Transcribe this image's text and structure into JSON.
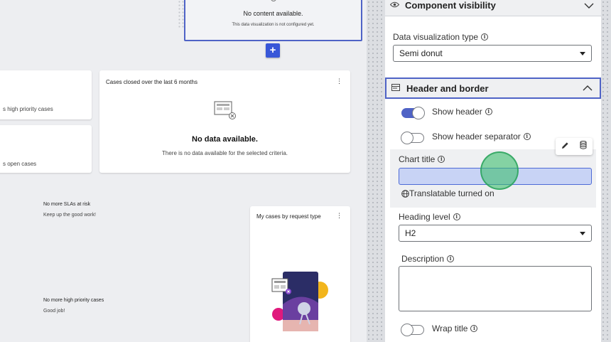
{
  "canvas": {
    "top_widget": {
      "title": "No content available.",
      "subtitle": "This data visualization is not configured yet."
    },
    "add_button": "+",
    "card_high_priority": {
      "text": "s high priority cases"
    },
    "card_open_cases": {
      "text": "s open cases"
    },
    "card_cases_closed": {
      "title": "Cases closed over the last 6 months",
      "heading": "No data available.",
      "text": "There is no data available for the selected criteria."
    },
    "sla_message": {
      "title": "No more SLAs at risk",
      "text": "Keep up the good work!"
    },
    "priority_message": {
      "title": "No more high priority cases",
      "text": "Good job!"
    },
    "card_request_type": {
      "title": "My cases by request type"
    },
    "kebab": "⋮"
  },
  "panel": {
    "component_visibility": {
      "title": "Component visibility",
      "icon": "eye-icon"
    },
    "data_viz_type": {
      "label": "Data visualization type",
      "value": "Semi donut"
    },
    "header_and_border": {
      "title": "Header and border",
      "icon": "window-icon"
    },
    "show_header": {
      "label": "Show header",
      "on": true
    },
    "show_header_separator": {
      "label": "Show header separator",
      "on": false
    },
    "chart_title": {
      "label": "Chart title",
      "value": "",
      "translatable": "Translatable turned on"
    },
    "heading_level": {
      "label": "Heading level",
      "value": "H2"
    },
    "description": {
      "label": "Description",
      "value": ""
    },
    "wrap_title": {
      "label": "Wrap title",
      "on": false
    }
  },
  "colors": {
    "accent": "#3857d8",
    "toggle_on": "#4f63c6",
    "selection_border": "#4f63c6",
    "input_highlight": "#c8d3f5"
  }
}
